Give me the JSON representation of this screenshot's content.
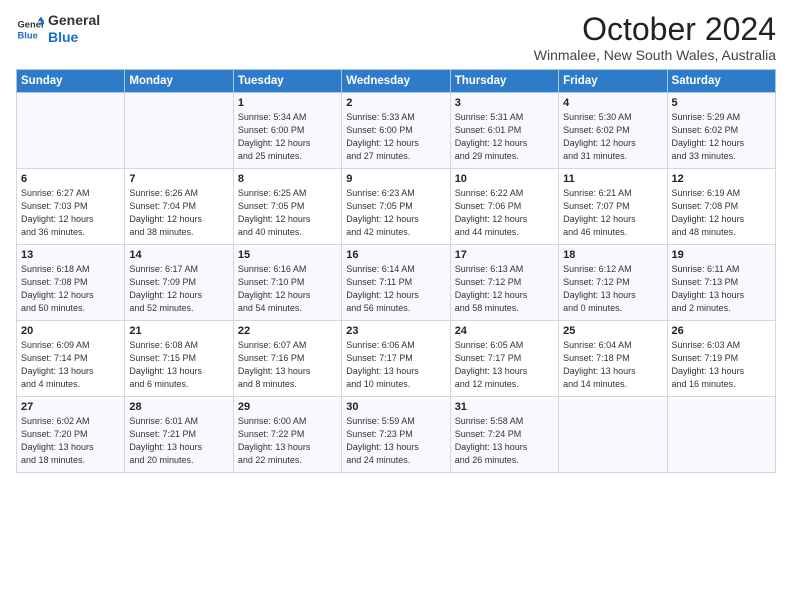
{
  "header": {
    "logo_line1": "General",
    "logo_line2": "Blue",
    "month": "October 2024",
    "location": "Winmalee, New South Wales, Australia"
  },
  "days_of_week": [
    "Sunday",
    "Monday",
    "Tuesday",
    "Wednesday",
    "Thursday",
    "Friday",
    "Saturday"
  ],
  "weeks": [
    [
      {
        "day": "",
        "content": ""
      },
      {
        "day": "",
        "content": ""
      },
      {
        "day": "1",
        "content": "Sunrise: 5:34 AM\nSunset: 6:00 PM\nDaylight: 12 hours\nand 25 minutes."
      },
      {
        "day": "2",
        "content": "Sunrise: 5:33 AM\nSunset: 6:00 PM\nDaylight: 12 hours\nand 27 minutes."
      },
      {
        "day": "3",
        "content": "Sunrise: 5:31 AM\nSunset: 6:01 PM\nDaylight: 12 hours\nand 29 minutes."
      },
      {
        "day": "4",
        "content": "Sunrise: 5:30 AM\nSunset: 6:02 PM\nDaylight: 12 hours\nand 31 minutes."
      },
      {
        "day": "5",
        "content": "Sunrise: 5:29 AM\nSunset: 6:02 PM\nDaylight: 12 hours\nand 33 minutes."
      }
    ],
    [
      {
        "day": "6",
        "content": "Sunrise: 6:27 AM\nSunset: 7:03 PM\nDaylight: 12 hours\nand 36 minutes."
      },
      {
        "day": "7",
        "content": "Sunrise: 6:26 AM\nSunset: 7:04 PM\nDaylight: 12 hours\nand 38 minutes."
      },
      {
        "day": "8",
        "content": "Sunrise: 6:25 AM\nSunset: 7:05 PM\nDaylight: 12 hours\nand 40 minutes."
      },
      {
        "day": "9",
        "content": "Sunrise: 6:23 AM\nSunset: 7:05 PM\nDaylight: 12 hours\nand 42 minutes."
      },
      {
        "day": "10",
        "content": "Sunrise: 6:22 AM\nSunset: 7:06 PM\nDaylight: 12 hours\nand 44 minutes."
      },
      {
        "day": "11",
        "content": "Sunrise: 6:21 AM\nSunset: 7:07 PM\nDaylight: 12 hours\nand 46 minutes."
      },
      {
        "day": "12",
        "content": "Sunrise: 6:19 AM\nSunset: 7:08 PM\nDaylight: 12 hours\nand 48 minutes."
      }
    ],
    [
      {
        "day": "13",
        "content": "Sunrise: 6:18 AM\nSunset: 7:08 PM\nDaylight: 12 hours\nand 50 minutes."
      },
      {
        "day": "14",
        "content": "Sunrise: 6:17 AM\nSunset: 7:09 PM\nDaylight: 12 hours\nand 52 minutes."
      },
      {
        "day": "15",
        "content": "Sunrise: 6:16 AM\nSunset: 7:10 PM\nDaylight: 12 hours\nand 54 minutes."
      },
      {
        "day": "16",
        "content": "Sunrise: 6:14 AM\nSunset: 7:11 PM\nDaylight: 12 hours\nand 56 minutes."
      },
      {
        "day": "17",
        "content": "Sunrise: 6:13 AM\nSunset: 7:12 PM\nDaylight: 12 hours\nand 58 minutes."
      },
      {
        "day": "18",
        "content": "Sunrise: 6:12 AM\nSunset: 7:12 PM\nDaylight: 13 hours\nand 0 minutes."
      },
      {
        "day": "19",
        "content": "Sunrise: 6:11 AM\nSunset: 7:13 PM\nDaylight: 13 hours\nand 2 minutes."
      }
    ],
    [
      {
        "day": "20",
        "content": "Sunrise: 6:09 AM\nSunset: 7:14 PM\nDaylight: 13 hours\nand 4 minutes."
      },
      {
        "day": "21",
        "content": "Sunrise: 6:08 AM\nSunset: 7:15 PM\nDaylight: 13 hours\nand 6 minutes."
      },
      {
        "day": "22",
        "content": "Sunrise: 6:07 AM\nSunset: 7:16 PM\nDaylight: 13 hours\nand 8 minutes."
      },
      {
        "day": "23",
        "content": "Sunrise: 6:06 AM\nSunset: 7:17 PM\nDaylight: 13 hours\nand 10 minutes."
      },
      {
        "day": "24",
        "content": "Sunrise: 6:05 AM\nSunset: 7:17 PM\nDaylight: 13 hours\nand 12 minutes."
      },
      {
        "day": "25",
        "content": "Sunrise: 6:04 AM\nSunset: 7:18 PM\nDaylight: 13 hours\nand 14 minutes."
      },
      {
        "day": "26",
        "content": "Sunrise: 6:03 AM\nSunset: 7:19 PM\nDaylight: 13 hours\nand 16 minutes."
      }
    ],
    [
      {
        "day": "27",
        "content": "Sunrise: 6:02 AM\nSunset: 7:20 PM\nDaylight: 13 hours\nand 18 minutes."
      },
      {
        "day": "28",
        "content": "Sunrise: 6:01 AM\nSunset: 7:21 PM\nDaylight: 13 hours\nand 20 minutes."
      },
      {
        "day": "29",
        "content": "Sunrise: 6:00 AM\nSunset: 7:22 PM\nDaylight: 13 hours\nand 22 minutes."
      },
      {
        "day": "30",
        "content": "Sunrise: 5:59 AM\nSunset: 7:23 PM\nDaylight: 13 hours\nand 24 minutes."
      },
      {
        "day": "31",
        "content": "Sunrise: 5:58 AM\nSunset: 7:24 PM\nDaylight: 13 hours\nand 26 minutes."
      },
      {
        "day": "",
        "content": ""
      },
      {
        "day": "",
        "content": ""
      }
    ]
  ]
}
